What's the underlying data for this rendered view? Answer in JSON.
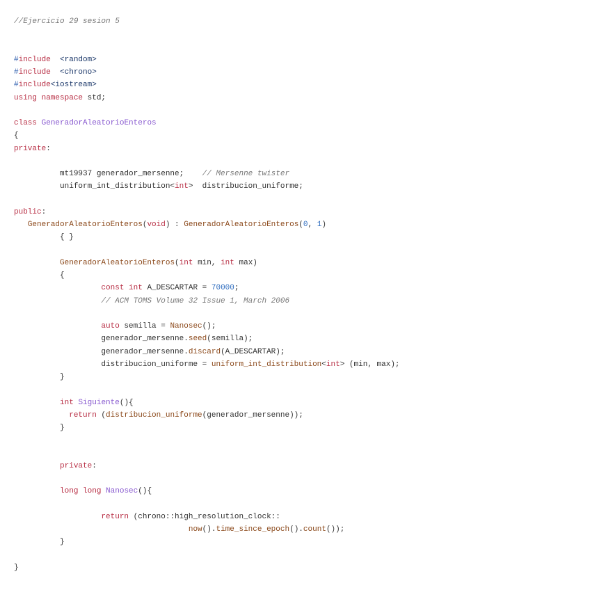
{
  "document": {
    "lines": [
      [
        [
          "c",
          "//Ejercicio 29 sesion 5"
        ]
      ],
      [],
      [],
      [
        [
          "p",
          "#"
        ],
        [
          "k",
          "include"
        ],
        [
          "",
          "  "
        ],
        [
          "h",
          "<random>"
        ]
      ],
      [
        [
          "p",
          "#"
        ],
        [
          "k",
          "include"
        ],
        [
          "",
          "  "
        ],
        [
          "h",
          "<chrono>"
        ]
      ],
      [
        [
          "p",
          "#"
        ],
        [
          "k",
          "include"
        ],
        [
          "h",
          "<iostream>"
        ]
      ],
      [
        [
          "k",
          "using namespace"
        ],
        [
          "",
          " std;"
        ]
      ],
      [],
      [
        [
          "k",
          "class"
        ],
        [
          "",
          " "
        ],
        [
          "t",
          "GeneradorAleatorioEnteros"
        ]
      ],
      [
        [
          "",
          "{"
        ]
      ],
      [
        [
          "k",
          "private"
        ],
        [
          "",
          ":"
        ]
      ],
      [],
      [
        [
          "",
          "          mt19937 generador_mersenne;    "
        ],
        [
          "c",
          "// Mersenne twister"
        ]
      ],
      [
        [
          "",
          "          uniform_int_distribution<"
        ],
        [
          "k",
          "int"
        ],
        [
          "",
          ">  distribucion_uniforme;"
        ]
      ],
      [],
      [
        [
          "k",
          "public"
        ],
        [
          "",
          ":"
        ]
      ],
      [
        [
          "",
          "   "
        ],
        [
          "f",
          "GeneradorAleatorioEnteros"
        ],
        [
          "",
          "("
        ],
        [
          "k",
          "void"
        ],
        [
          "",
          ") : "
        ],
        [
          "f",
          "GeneradorAleatorioEnteros"
        ],
        [
          "",
          "("
        ],
        [
          "n",
          "0"
        ],
        [
          "",
          ", "
        ],
        [
          "n",
          "1"
        ],
        [
          "",
          ")"
        ]
      ],
      [
        [
          "",
          "          { }"
        ]
      ],
      [],
      [
        [
          "",
          "          "
        ],
        [
          "f",
          "GeneradorAleatorioEnteros"
        ],
        [
          "",
          "("
        ],
        [
          "k",
          "int"
        ],
        [
          "",
          " min, "
        ],
        [
          "k",
          "int"
        ],
        [
          "",
          " max)"
        ]
      ],
      [
        [
          "",
          "          {"
        ]
      ],
      [
        [
          "",
          "                   "
        ],
        [
          "k",
          "const int"
        ],
        [
          "",
          " A_DESCARTAR = "
        ],
        [
          "n",
          "70000"
        ],
        [
          "",
          ";"
        ]
      ],
      [
        [
          "",
          "                   "
        ],
        [
          "c",
          "// ACM TOMS Volume 32 Issue 1, March 2006"
        ]
      ],
      [],
      [
        [
          "",
          "                   "
        ],
        [
          "k",
          "auto"
        ],
        [
          "",
          " semilla = "
        ],
        [
          "f",
          "Nanosec"
        ],
        [
          "",
          "();"
        ]
      ],
      [
        [
          "",
          "                   generador_mersenne."
        ],
        [
          "f",
          "seed"
        ],
        [
          "",
          "(semilla);"
        ]
      ],
      [
        [
          "",
          "                   generador_mersenne."
        ],
        [
          "f",
          "discard"
        ],
        [
          "",
          "(A_DESCARTAR);"
        ]
      ],
      [
        [
          "",
          "                   distribucion_uniforme = "
        ],
        [
          "f",
          "uniform_int_distribution"
        ],
        [
          "",
          "<"
        ],
        [
          "k",
          "int"
        ],
        [
          "",
          "> (min, max);"
        ]
      ],
      [
        [
          "",
          "          }"
        ]
      ],
      [],
      [
        [
          "",
          "          "
        ],
        [
          "k",
          "int"
        ],
        [
          "",
          " "
        ],
        [
          "t",
          "Siguiente"
        ],
        [
          "",
          "(){"
        ]
      ],
      [
        [
          "",
          "            "
        ],
        [
          "k",
          "return"
        ],
        [
          "",
          " ("
        ],
        [
          "f",
          "distribucion_uniforme"
        ],
        [
          "",
          "(generador_mersenne));"
        ]
      ],
      [
        [
          "",
          "          }"
        ]
      ],
      [],
      [],
      [
        [
          "",
          "          "
        ],
        [
          "k",
          "private"
        ],
        [
          "",
          ":"
        ]
      ],
      [],
      [
        [
          "",
          "          "
        ],
        [
          "k",
          "long long"
        ],
        [
          "",
          " "
        ],
        [
          "t",
          "Nanosec"
        ],
        [
          "",
          "(){"
        ]
      ],
      [],
      [
        [
          "",
          "                   "
        ],
        [
          "k",
          "return"
        ],
        [
          "",
          " (chrono::high_resolution_clock::"
        ]
      ],
      [
        [
          "",
          "                                      "
        ],
        [
          "f",
          "now"
        ],
        [
          "",
          "()."
        ],
        [
          "f",
          "time_since_epoch"
        ],
        [
          "",
          "()."
        ],
        [
          "f",
          "count"
        ],
        [
          "",
          "());"
        ]
      ],
      [
        [
          "",
          "          }"
        ]
      ],
      [],
      [
        [
          "",
          "}"
        ]
      ]
    ]
  }
}
